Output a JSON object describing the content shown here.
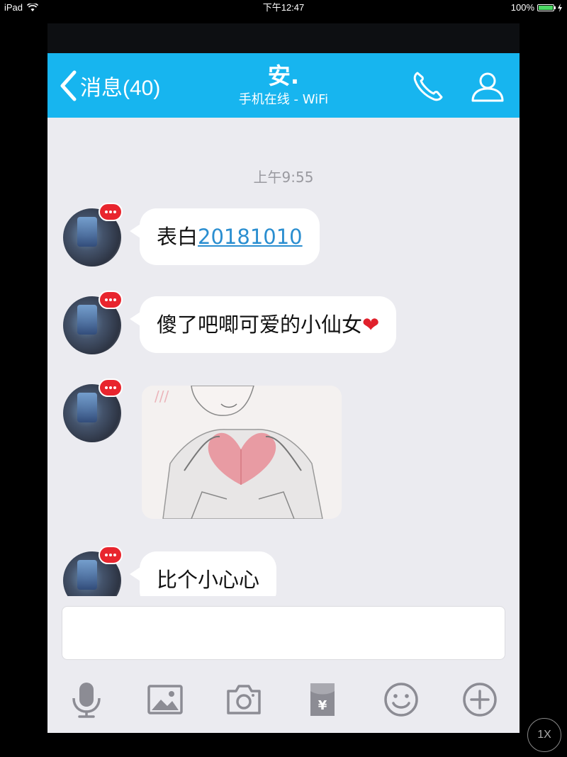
{
  "status_bar": {
    "device": "iPad",
    "time": "下午12:47",
    "battery": "100%",
    "battery_level": 1.0
  },
  "header": {
    "back_label": "消息(40)",
    "contact_name": "安.",
    "status": "手机在线 - WiFi"
  },
  "chat": {
    "timestamp": "上午9:55",
    "messages": [
      {
        "type": "text",
        "prefix": "表白",
        "link": "20181010"
      },
      {
        "type": "text",
        "text": "傻了吧唧可爱的小仙女",
        "emoji": "❤"
      },
      {
        "type": "image",
        "description": "heart-hands-drawing"
      },
      {
        "type": "text",
        "text": "比个小心心"
      }
    ]
  },
  "input": {
    "placeholder": ""
  },
  "toolbar": [
    "microphone-icon",
    "image-icon",
    "camera-icon",
    "red-packet-icon",
    "emoji-icon",
    "plus-icon"
  ],
  "zoom_button": {
    "label": "1X"
  },
  "colors": {
    "header": "#17b5ef",
    "chat_bg": "#ebebf0",
    "badge": "#e8252e",
    "link": "#2a8ed0"
  }
}
